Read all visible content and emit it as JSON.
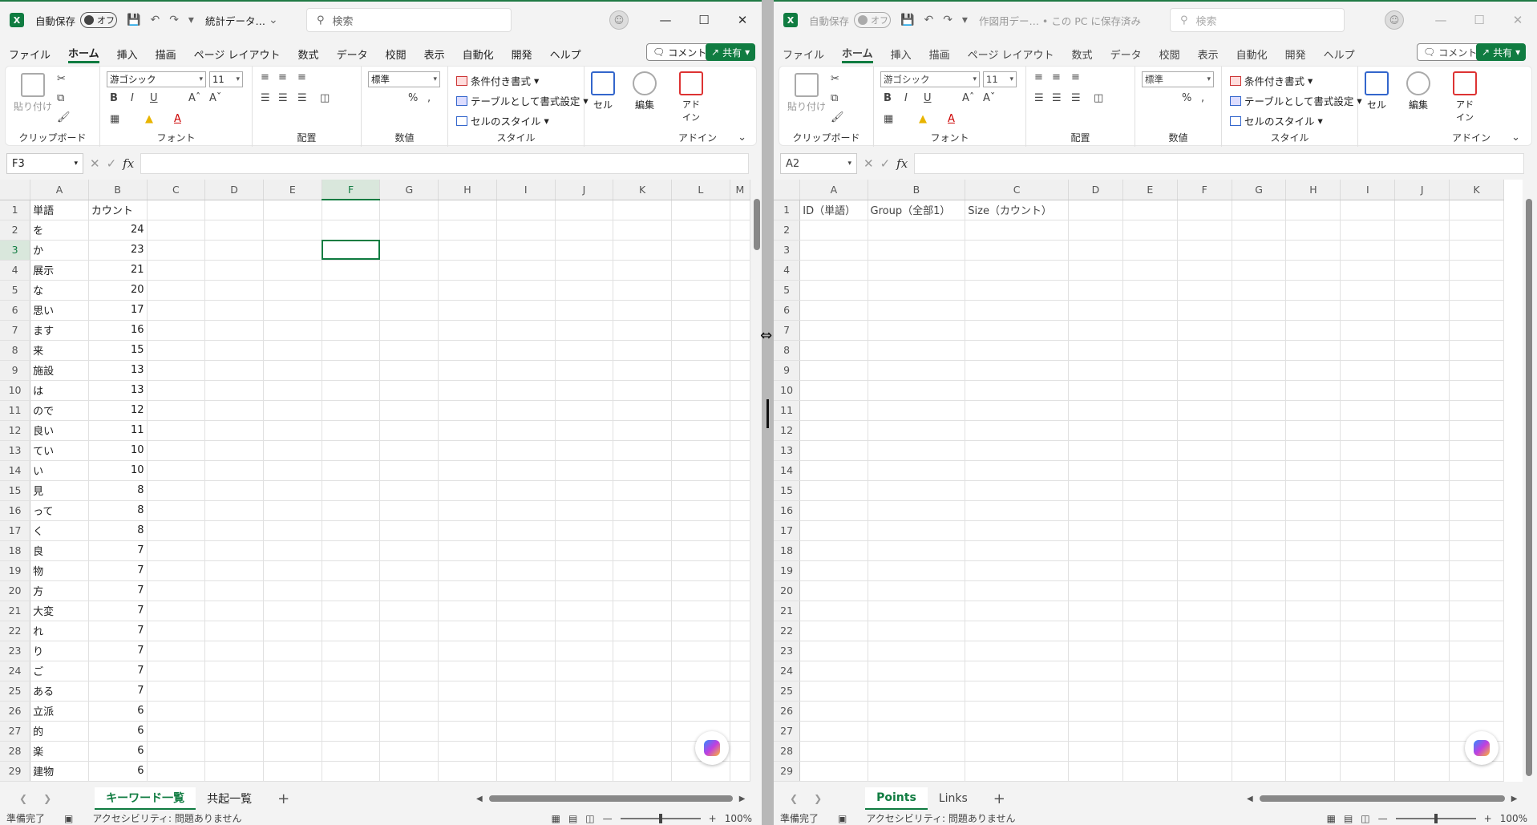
{
  "left": {
    "autosave_label": "自動保存",
    "autosave_state": "オフ",
    "file_title": "統計データ…",
    "search_placeholder": "検索",
    "menus": [
      "ファイル",
      "ホーム",
      "挿入",
      "描画",
      "ページ レイアウト",
      "数式",
      "データ",
      "校閲",
      "表示",
      "自動化",
      "開発",
      "ヘルプ"
    ],
    "comment_label": "コメント",
    "share_label": "共有",
    "ribbon": {
      "paste": "貼り付け",
      "clipboard": "クリップボード",
      "font_name": "游ゴシック",
      "font_size": "11",
      "font": "フォント",
      "alignment": "配置",
      "number_format": "標準",
      "number": "数値",
      "cond_format": "条件付き書式",
      "table_format": "テーブルとして書式設定",
      "cell_styles": "セルのスタイル",
      "styles": "スタイル",
      "cells": "セル",
      "editing": "編集",
      "addin": "アド\nイン",
      "addins": "アドイン"
    },
    "namebox": "F3",
    "columns": [
      "A",
      "B",
      "C",
      "D",
      "E",
      "F",
      "G",
      "H",
      "I",
      "J",
      "K",
      "L",
      "M"
    ],
    "rows": [
      [
        "単語",
        "カウント"
      ],
      [
        "を",
        "24"
      ],
      [
        "か",
        "23"
      ],
      [
        "展示",
        "21"
      ],
      [
        "な",
        "20"
      ],
      [
        "思い",
        "17"
      ],
      [
        "ます",
        "16"
      ],
      [
        "来",
        "15"
      ],
      [
        "施設",
        "13"
      ],
      [
        "は",
        "13"
      ],
      [
        "ので",
        "12"
      ],
      [
        "良い",
        "11"
      ],
      [
        "てい",
        "10"
      ],
      [
        "い",
        "10"
      ],
      [
        "見",
        "8"
      ],
      [
        "って",
        "8"
      ],
      [
        "く",
        "8"
      ],
      [
        "良",
        "7"
      ],
      [
        "物",
        "7"
      ],
      [
        "方",
        "7"
      ],
      [
        "大変",
        "7"
      ],
      [
        "れ",
        "7"
      ],
      [
        "り",
        "7"
      ],
      [
        "ご",
        "7"
      ],
      [
        "ある",
        "7"
      ],
      [
        "立派",
        "6"
      ],
      [
        "的",
        "6"
      ],
      [
        "楽",
        "6"
      ],
      [
        "建物",
        "6"
      ]
    ],
    "sheets": [
      "キーワード一覧",
      "共起一覧"
    ],
    "status_ready": "準備完了",
    "accessibility": "アクセシビリティ: 問題ありません",
    "zoom": "100%"
  },
  "right": {
    "autosave_label": "自動保存",
    "autosave_state": "オフ",
    "file_title": "作図用デー… • この PC に保存済み",
    "search_placeholder": "検索",
    "menus": [
      "ファイル",
      "ホーム",
      "挿入",
      "描画",
      "ページ レイアウト",
      "数式",
      "データ",
      "校閲",
      "表示",
      "自動化",
      "開発",
      "ヘルプ"
    ],
    "comment_label": "コメント",
    "share_label": "共有",
    "namebox": "A2",
    "columns": [
      "A",
      "B",
      "C",
      "D",
      "E",
      "F",
      "G",
      "H",
      "I",
      "J",
      "K"
    ],
    "header_row": [
      "ID（単語）",
      "Group（全部1）",
      "Size（カウント）"
    ],
    "row_count": 29,
    "sheets": [
      "Points",
      "Links"
    ],
    "status_ready": "準備完了",
    "accessibility": "アクセシビリティ: 問題ありません",
    "zoom": "100%"
  }
}
